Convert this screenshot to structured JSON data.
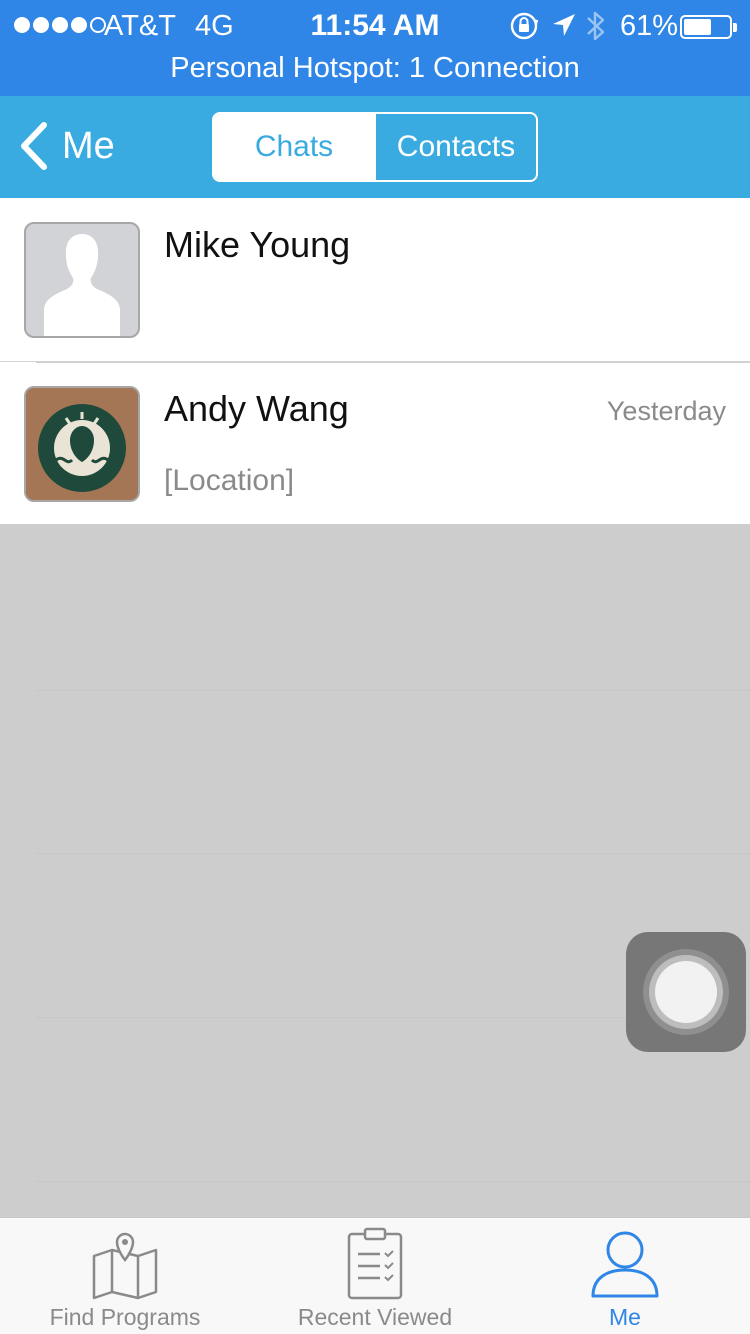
{
  "status_bar": {
    "carrier": "AT&T",
    "network": "4G",
    "time": "11:54 AM",
    "battery_percent": "61%",
    "battery_level": 0.61,
    "hotspot_text": "Personal Hotspot: 1 Connection"
  },
  "nav": {
    "back_label": "Me",
    "tabs": [
      {
        "label": "Chats",
        "active": true
      },
      {
        "label": "Contacts",
        "active": false
      }
    ]
  },
  "chats": [
    {
      "name": "Mike Young",
      "time": "",
      "preview": "",
      "avatar_icon": "person-silhouette-icon"
    },
    {
      "name": "Andy Wang",
      "time": "Yesterday",
      "preview": "[Location]",
      "avatar_icon": "coffee-logo-icon"
    }
  ],
  "tab_bar": {
    "items": [
      {
        "label": "Find Programs",
        "icon": "map-pin-icon",
        "active": false
      },
      {
        "label": "Recent Viewed",
        "icon": "clipboard-icon",
        "active": false
      },
      {
        "label": "Me",
        "icon": "person-icon",
        "active": true
      }
    ]
  },
  "colors": {
    "status_bar": "#2f86e6",
    "nav_bar": "#39abe0",
    "accent": "#2f86e6",
    "background": "#cdcdcd"
  }
}
